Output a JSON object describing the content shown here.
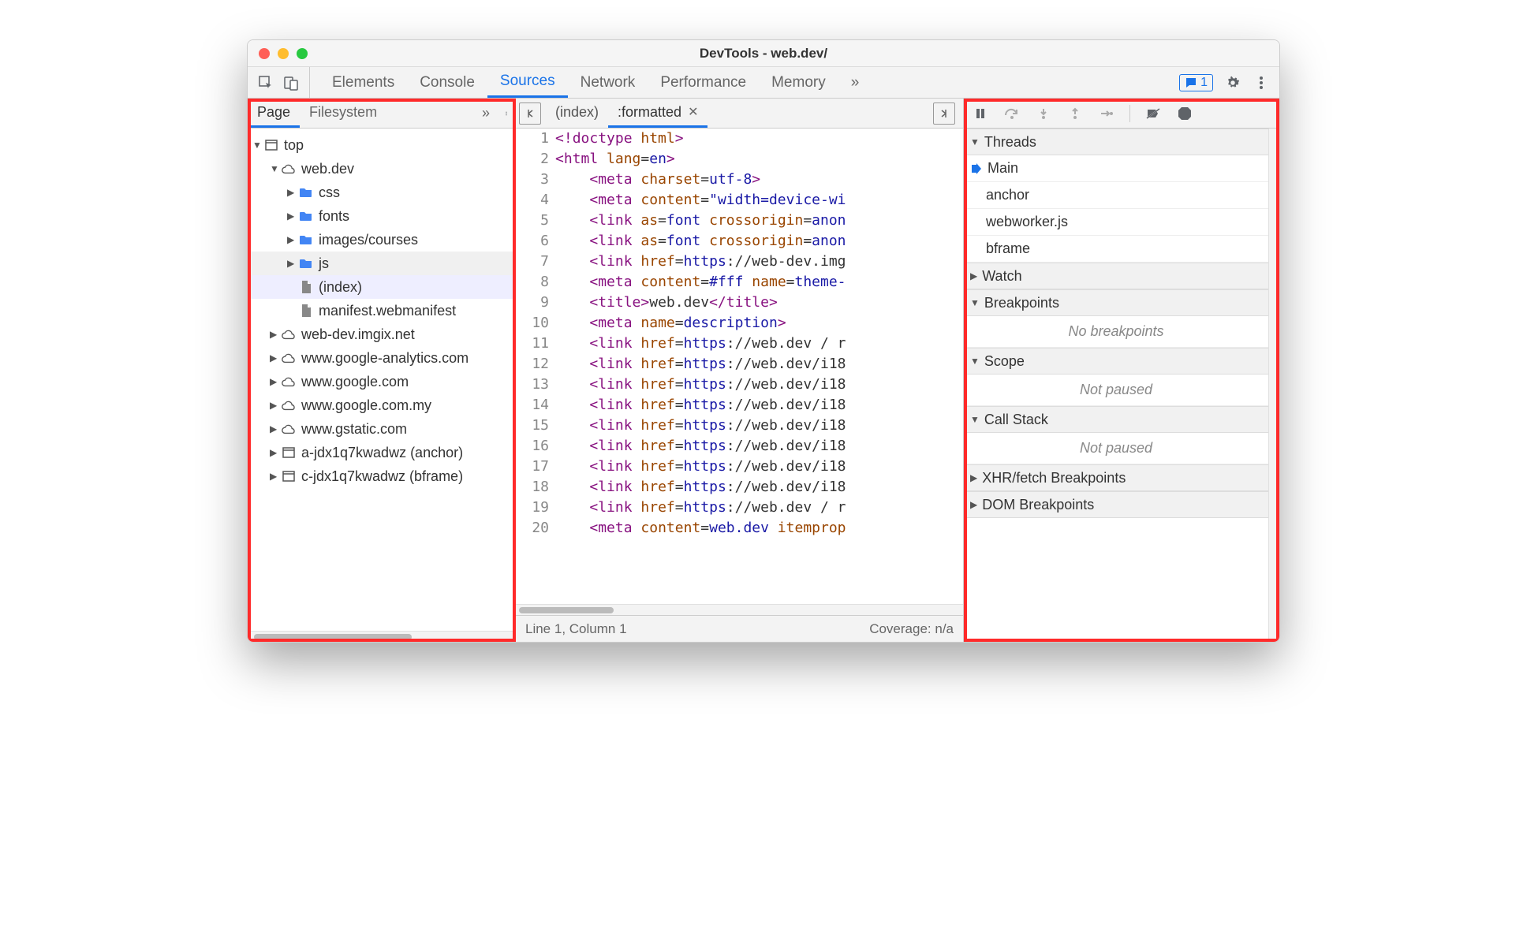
{
  "window": {
    "title": "DevTools - web.dev/"
  },
  "toolbar": {
    "tabs": [
      "Elements",
      "Console",
      "Sources",
      "Network",
      "Performance",
      "Memory"
    ],
    "active_tab": "Sources",
    "overflow_label": "»",
    "issue_count": "1"
  },
  "navigator": {
    "subtabs": [
      "Page",
      "Filesystem"
    ],
    "active_subtab": "Page",
    "overflow": "»",
    "tree": [
      {
        "depth": 0,
        "expand": "down",
        "icon": "frame",
        "label": "top"
      },
      {
        "depth": 1,
        "expand": "down",
        "icon": "cloud",
        "label": "web.dev"
      },
      {
        "depth": 2,
        "expand": "right",
        "icon": "folder",
        "label": "css"
      },
      {
        "depth": 2,
        "expand": "right",
        "icon": "folder",
        "label": "fonts"
      },
      {
        "depth": 2,
        "expand": "right",
        "icon": "folder",
        "label": "images/courses"
      },
      {
        "depth": 2,
        "expand": "right",
        "icon": "folder",
        "label": "js",
        "hov": true
      },
      {
        "depth": 2,
        "expand": "",
        "icon": "file",
        "label": "(index)",
        "sel": true
      },
      {
        "depth": 2,
        "expand": "",
        "icon": "file",
        "label": "manifest.webmanifest"
      },
      {
        "depth": 1,
        "expand": "right",
        "icon": "cloud",
        "label": "web-dev.imgix.net"
      },
      {
        "depth": 1,
        "expand": "right",
        "icon": "cloud",
        "label": "www.google-analytics.com"
      },
      {
        "depth": 1,
        "expand": "right",
        "icon": "cloud",
        "label": "www.google.com"
      },
      {
        "depth": 1,
        "expand": "right",
        "icon": "cloud",
        "label": "www.google.com.my"
      },
      {
        "depth": 1,
        "expand": "right",
        "icon": "cloud",
        "label": "www.gstatic.com"
      },
      {
        "depth": 1,
        "expand": "right",
        "icon": "frame",
        "label": "a-jdx1q7kwadwz (anchor)"
      },
      {
        "depth": 1,
        "expand": "right",
        "icon": "frame",
        "label": "c-jdx1q7kwadwz (bframe)"
      }
    ]
  },
  "editor": {
    "file_tabs": [
      {
        "label": "(index)",
        "active": false
      },
      {
        "label": ":formatted",
        "active": true,
        "closable": true
      }
    ],
    "lines": [
      {
        "n": 1,
        "segs": [
          [
            "punc",
            "<!"
          ],
          [
            "tag",
            "doctype"
          ],
          [
            "",
            ""
          ],
          [
            "attr",
            " html"
          ],
          [
            "punc",
            ">"
          ]
        ]
      },
      {
        "n": 2,
        "segs": [
          [
            "punc",
            "<"
          ],
          [
            "tag",
            "html"
          ],
          [
            "attr",
            " lang"
          ],
          [
            "",
            "="
          ],
          [
            "val",
            "en"
          ],
          [
            "punc",
            ">"
          ]
        ]
      },
      {
        "n": 3,
        "segs": [
          [
            "",
            "    "
          ],
          [
            "punc",
            "<"
          ],
          [
            "tag",
            "meta"
          ],
          [
            "attr",
            " charset"
          ],
          [
            "",
            "="
          ],
          [
            "val",
            "utf-8"
          ],
          [
            "punc",
            ">"
          ]
        ]
      },
      {
        "n": 4,
        "segs": [
          [
            "",
            "    "
          ],
          [
            "punc",
            "<"
          ],
          [
            "tag",
            "meta"
          ],
          [
            "attr",
            " content"
          ],
          [
            "",
            "="
          ],
          [
            "val",
            "\"width=device-wi"
          ]
        ]
      },
      {
        "n": 5,
        "segs": [
          [
            "",
            "    "
          ],
          [
            "punc",
            "<"
          ],
          [
            "tag",
            "link"
          ],
          [
            "attr",
            " as"
          ],
          [
            "",
            "="
          ],
          [
            "val",
            "font"
          ],
          [
            "attr",
            " crossorigin"
          ],
          [
            "",
            "="
          ],
          [
            "val",
            "anon"
          ]
        ]
      },
      {
        "n": 6,
        "segs": [
          [
            "",
            "    "
          ],
          [
            "punc",
            "<"
          ],
          [
            "tag",
            "link"
          ],
          [
            "attr",
            " as"
          ],
          [
            "",
            "="
          ],
          [
            "val",
            "font"
          ],
          [
            "attr",
            " crossorigin"
          ],
          [
            "",
            "="
          ],
          [
            "val",
            "anon"
          ]
        ]
      },
      {
        "n": 7,
        "segs": [
          [
            "",
            "    "
          ],
          [
            "punc",
            "<"
          ],
          [
            "tag",
            "link"
          ],
          [
            "attr",
            " href"
          ],
          [
            "",
            "="
          ],
          [
            "val",
            "https"
          ],
          [
            "",
            ":"
          ],
          [
            "",
            "//web-dev.img"
          ]
        ]
      },
      {
        "n": 8,
        "segs": [
          [
            "",
            "    "
          ],
          [
            "punc",
            "<"
          ],
          [
            "tag",
            "meta"
          ],
          [
            "attr",
            " content"
          ],
          [
            "",
            "="
          ],
          [
            "val",
            "#fff"
          ],
          [
            "attr",
            " name"
          ],
          [
            "",
            "="
          ],
          [
            "val",
            "theme-"
          ]
        ]
      },
      {
        "n": 9,
        "segs": [
          [
            "",
            "    "
          ],
          [
            "punc",
            "<"
          ],
          [
            "tag",
            "title"
          ],
          [
            "punc",
            ">"
          ],
          [
            "",
            "web.dev"
          ],
          [
            "punc",
            "</"
          ],
          [
            "tag",
            "title"
          ],
          [
            "punc",
            ">"
          ]
        ]
      },
      {
        "n": 10,
        "segs": [
          [
            "",
            "    "
          ],
          [
            "punc",
            "<"
          ],
          [
            "tag",
            "meta"
          ],
          [
            "attr",
            " name"
          ],
          [
            "",
            "="
          ],
          [
            "val",
            "description"
          ],
          [
            "punc",
            ">"
          ]
        ]
      },
      {
        "n": 11,
        "segs": [
          [
            "",
            "    "
          ],
          [
            "punc",
            "<"
          ],
          [
            "tag",
            "link"
          ],
          [
            "attr",
            " href"
          ],
          [
            "",
            "="
          ],
          [
            "val",
            "https"
          ],
          [
            "",
            ":"
          ],
          [
            "",
            "//web.dev / r"
          ]
        ]
      },
      {
        "n": 12,
        "segs": [
          [
            "",
            "    "
          ],
          [
            "punc",
            "<"
          ],
          [
            "tag",
            "link"
          ],
          [
            "attr",
            " href"
          ],
          [
            "",
            "="
          ],
          [
            "val",
            "https"
          ],
          [
            "",
            ":"
          ],
          [
            "",
            "//web.dev/i18"
          ]
        ]
      },
      {
        "n": 13,
        "segs": [
          [
            "",
            "    "
          ],
          [
            "punc",
            "<"
          ],
          [
            "tag",
            "link"
          ],
          [
            "attr",
            " href"
          ],
          [
            "",
            "="
          ],
          [
            "val",
            "https"
          ],
          [
            "",
            ":"
          ],
          [
            "",
            "//web.dev/i18"
          ]
        ]
      },
      {
        "n": 14,
        "segs": [
          [
            "",
            "    "
          ],
          [
            "punc",
            "<"
          ],
          [
            "tag",
            "link"
          ],
          [
            "attr",
            " href"
          ],
          [
            "",
            "="
          ],
          [
            "val",
            "https"
          ],
          [
            "",
            ":"
          ],
          [
            "",
            "//web.dev/i18"
          ]
        ]
      },
      {
        "n": 15,
        "segs": [
          [
            "",
            "    "
          ],
          [
            "punc",
            "<"
          ],
          [
            "tag",
            "link"
          ],
          [
            "attr",
            " href"
          ],
          [
            "",
            "="
          ],
          [
            "val",
            "https"
          ],
          [
            "",
            ":"
          ],
          [
            "",
            "//web.dev/i18"
          ]
        ]
      },
      {
        "n": 16,
        "segs": [
          [
            "",
            "    "
          ],
          [
            "punc",
            "<"
          ],
          [
            "tag",
            "link"
          ],
          [
            "attr",
            " href"
          ],
          [
            "",
            "="
          ],
          [
            "val",
            "https"
          ],
          [
            "",
            ":"
          ],
          [
            "",
            "//web.dev/i18"
          ]
        ]
      },
      {
        "n": 17,
        "segs": [
          [
            "",
            "    "
          ],
          [
            "punc",
            "<"
          ],
          [
            "tag",
            "link"
          ],
          [
            "attr",
            " href"
          ],
          [
            "",
            "="
          ],
          [
            "val",
            "https"
          ],
          [
            "",
            ":"
          ],
          [
            "",
            "//web.dev/i18"
          ]
        ]
      },
      {
        "n": 18,
        "segs": [
          [
            "",
            "    "
          ],
          [
            "punc",
            "<"
          ],
          [
            "tag",
            "link"
          ],
          [
            "attr",
            " href"
          ],
          [
            "",
            "="
          ],
          [
            "val",
            "https"
          ],
          [
            "",
            ":"
          ],
          [
            "",
            "//web.dev/i18"
          ]
        ]
      },
      {
        "n": 19,
        "segs": [
          [
            "",
            "    "
          ],
          [
            "punc",
            "<"
          ],
          [
            "tag",
            "link"
          ],
          [
            "attr",
            " href"
          ],
          [
            "",
            "="
          ],
          [
            "val",
            "https"
          ],
          [
            "",
            ":"
          ],
          [
            "",
            "//web.dev / r"
          ]
        ]
      },
      {
        "n": 20,
        "segs": [
          [
            "",
            "    "
          ],
          [
            "punc",
            "<"
          ],
          [
            "tag",
            "meta"
          ],
          [
            "attr",
            " content"
          ],
          [
            "",
            "="
          ],
          [
            "val",
            "web.dev"
          ],
          [
            "attr",
            " itemprop"
          ]
        ]
      }
    ],
    "status_left": "Line 1, Column 1",
    "status_right": "Coverage: n/a"
  },
  "debugger": {
    "sections": [
      {
        "title": "Threads",
        "open": true,
        "items": [
          {
            "label": "Main",
            "active": true
          },
          {
            "label": "anchor"
          },
          {
            "label": "webworker.js"
          },
          {
            "label": "bframe"
          }
        ]
      },
      {
        "title": "Watch",
        "open": false
      },
      {
        "title": "Breakpoints",
        "open": true,
        "empty": "No breakpoints"
      },
      {
        "title": "Scope",
        "open": true,
        "empty": "Not paused"
      },
      {
        "title": "Call Stack",
        "open": true,
        "empty": "Not paused"
      },
      {
        "title": "XHR/fetch Breakpoints",
        "open": false
      },
      {
        "title": "DOM Breakpoints",
        "open": false
      }
    ]
  }
}
